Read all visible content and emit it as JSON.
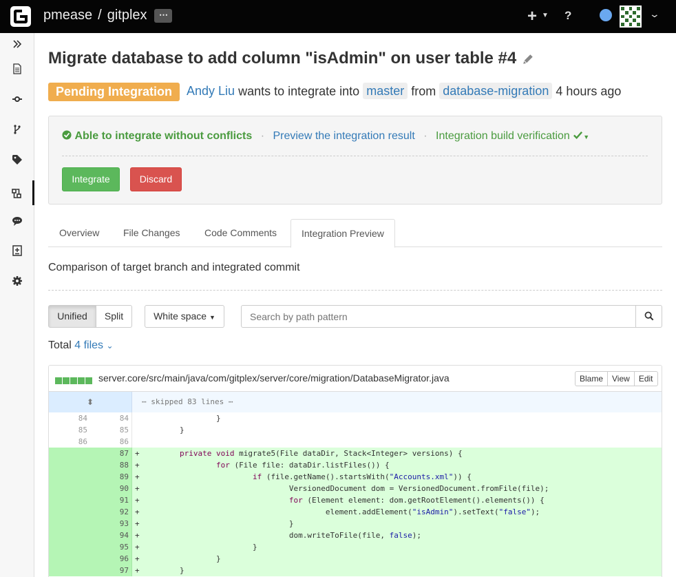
{
  "navbar": {
    "project_owner": "pmease",
    "separator": "/",
    "project_name": "gitplex",
    "more_label": "⋯",
    "plus_label": "+",
    "help_label": "?"
  },
  "sidebar": {
    "items": [
      {
        "name": "expand",
        "active": false
      },
      {
        "name": "files",
        "active": false
      },
      {
        "name": "commits",
        "active": false
      },
      {
        "name": "branches",
        "active": false
      },
      {
        "name": "tags",
        "active": false
      },
      {
        "name": "pull-requests",
        "active": true
      },
      {
        "name": "comments",
        "active": false
      },
      {
        "name": "compare",
        "active": false
      },
      {
        "name": "settings",
        "active": false
      }
    ]
  },
  "request": {
    "title": "Migrate database to add column \"isAdmin\" on user table #4",
    "status": "Pending Integration",
    "user": "Andy Liu",
    "wants_text": "wants to integrate into",
    "target_branch": "master",
    "from_text": "from",
    "source_branch": "database-migration",
    "time": "4 hours ago"
  },
  "integration_panel": {
    "ok_text": "Able to integrate without conflicts",
    "preview_link": "Preview the integration result",
    "verification": "Integration build verification",
    "integrate_button": "Integrate",
    "discard_button": "Discard"
  },
  "tabs": [
    {
      "label": "Overview",
      "active": false
    },
    {
      "label": "File Changes",
      "active": false
    },
    {
      "label": "Code Comments",
      "active": false
    },
    {
      "label": "Integration Preview",
      "active": true
    }
  ],
  "description": "Comparison of target branch and integrated commit",
  "toolbar": {
    "unified_label": "Unified",
    "split_label": "Split",
    "whitespace_label": "White space",
    "search_placeholder": "Search by path pattern"
  },
  "total": {
    "label": "Total",
    "files": "4 files"
  },
  "file": {
    "path": "server.core/src/main/java/com/gitplex/server/core/migration/DatabaseMigrator.java",
    "blame": "Blame",
    "view": "View",
    "edit": "Edit",
    "skipped": "⋯ skipped 83 lines ⋯"
  },
  "colors": {
    "navbar": "#050505",
    "pending": "#f0ad4e",
    "integrate": "#5cb85c",
    "discard": "#d9534f",
    "link": "#337ab7",
    "added_line": "#dbffdb"
  }
}
